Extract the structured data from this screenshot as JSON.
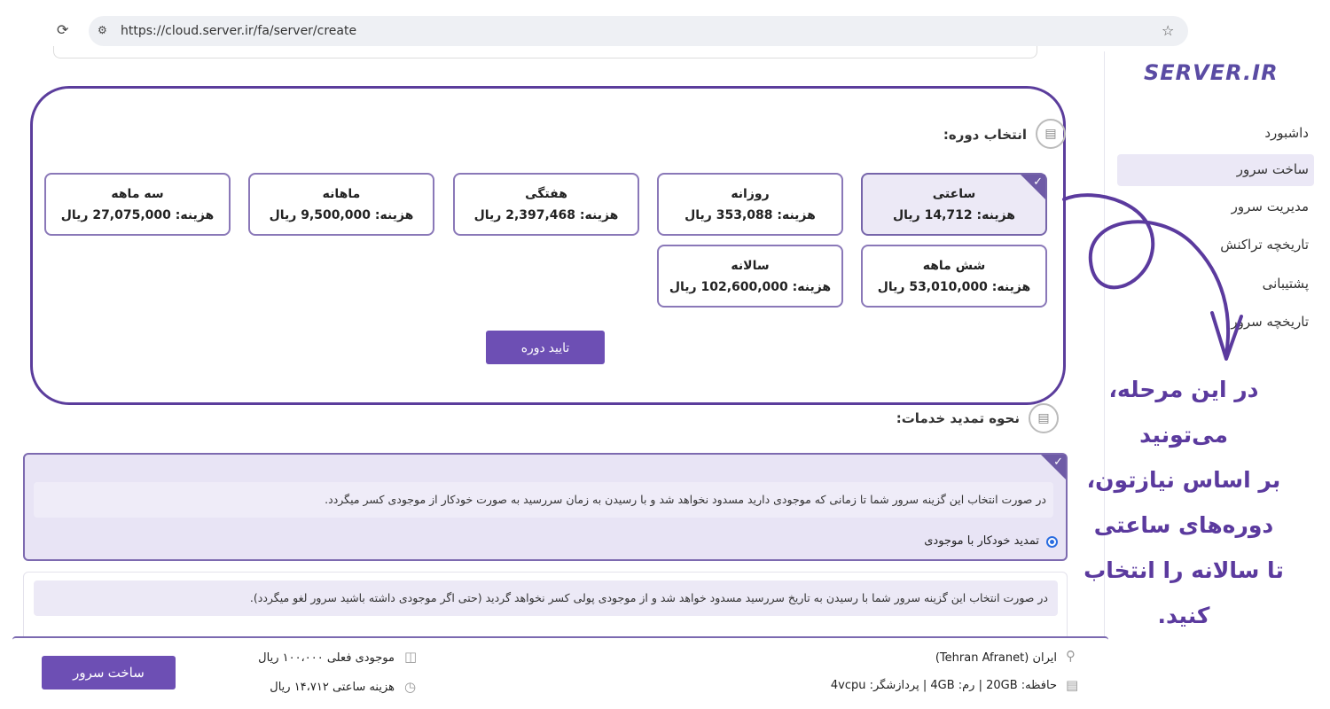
{
  "browser": {
    "url": "https://cloud.server.ir/fa/server/create"
  },
  "logo": {
    "text": "SERVER.IR"
  },
  "sidebar": {
    "items": [
      {
        "label": "داشبورد"
      },
      {
        "label": "ساخت سرور"
      },
      {
        "label": "مدیریت سرور"
      },
      {
        "label": "تاریخچه تراکنش"
      },
      {
        "label": "پشتیبانی"
      },
      {
        "label": "تاریخچه سرور"
      }
    ],
    "active_index": 1
  },
  "period_section": {
    "title": "انتخاب دوره:",
    "cards": [
      {
        "name": "ساعتی",
        "price": "هزینه: 14,712 ریال",
        "selected": true
      },
      {
        "name": "روزانه",
        "price": "هزینه: 353,088 ریال",
        "selected": false
      },
      {
        "name": "هفتگی",
        "price": "هزینه: 2,397,468 ریال",
        "selected": false
      },
      {
        "name": "ماهانه",
        "price": "هزینه: 9,500,000 ریال",
        "selected": false
      },
      {
        "name": "سه ماهه",
        "price": "هزینه: 27,075,000 ریال",
        "selected": false
      },
      {
        "name": "شش ماهه",
        "price": "هزینه: 53,010,000 ریال",
        "selected": false
      },
      {
        "name": "سالانه",
        "price": "هزینه: 102,600,000 ریال",
        "selected": false
      }
    ],
    "confirm_label": "تایید دوره"
  },
  "renewal_section": {
    "title": "نحوه تمدید خدمات:",
    "options": [
      {
        "description": "در صورت انتخاب این گزینه سرور شما تا زمانی که موجودی دارید مسدود نخواهد شد و با رسیدن به زمان سررسید به صورت خودکار از موجودی کسر میگردد.",
        "label": "تمدید خودکار با موجودی",
        "selected": true
      },
      {
        "description": "در صورت انتخاب این گزینه سرور شما با رسیدن به تاریخ سررسید مسدود خواهد شد و از موجودی پولی کسر نخواهد گردید (حتی اگر موجودی داشته باشید سرور لغو میگردد).",
        "selected": false
      }
    ]
  },
  "bottom_bar": {
    "location": "ایران (Tehran Afranet)",
    "specs": "حافظه: 20GB | رم: 4GB | پردازشگر: 4vcpu",
    "balance": "موجودی فعلی ۱۰۰،۰۰۰ ریال",
    "hourly_cost": "هزینه ساعتی ۱۴،۷۱۲ ریال",
    "build_label": "ساخت سرور"
  },
  "annotation": {
    "lines": [
      "در این مرحله، می‌تونید",
      "بر اساس نیازتون،",
      "دوره‌های ساعتی",
      "تا سالانه را انتخاب کنید."
    ]
  },
  "icons": {
    "reload": "reload-icon",
    "site_settings": "site-settings-icon",
    "bookmark": "star-icon",
    "period": "card-icon",
    "renewal": "card-icon",
    "location": "location-pin-icon",
    "specs": "server-icon",
    "balance": "wallet-icon",
    "hourly": "clock-icon"
  },
  "colors": {
    "accent": "#6d4fb4",
    "frame": "#5b3d9c",
    "annotation": "#5b3a9e"
  }
}
